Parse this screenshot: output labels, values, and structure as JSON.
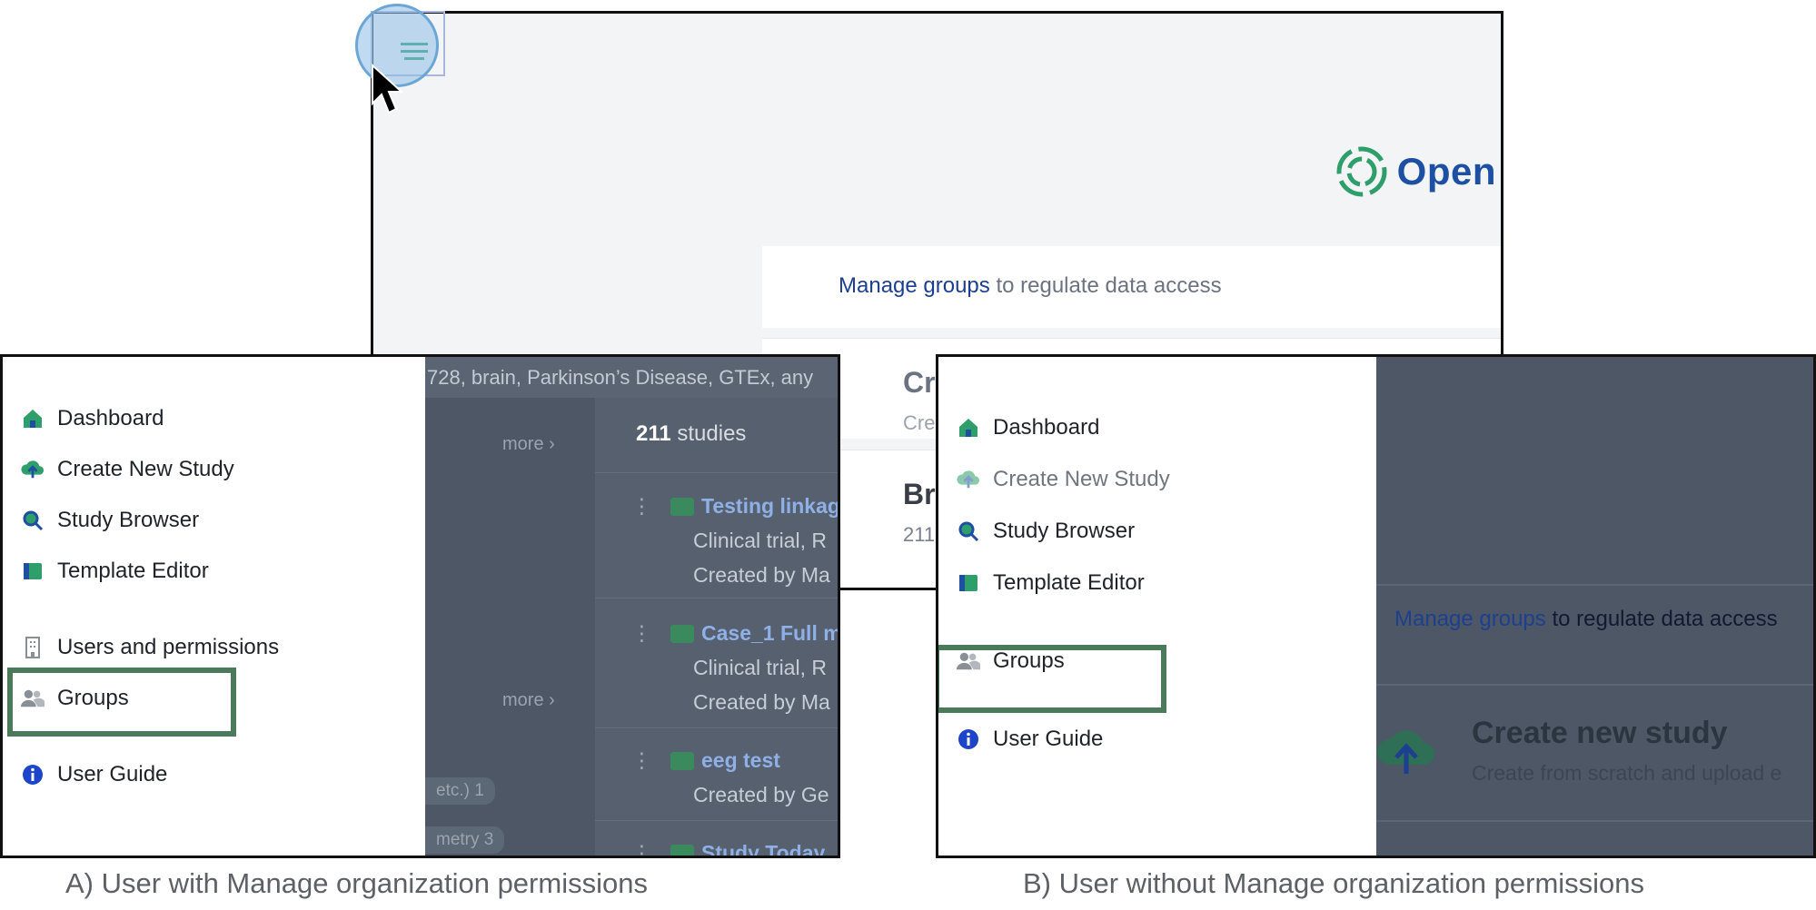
{
  "background_app": {
    "logo_text": "Open",
    "banner_link": "Manage groups",
    "banner_rest": " to regulate data access",
    "create_card_title": "Cr",
    "create_card_sub": "Cre",
    "browse_card_title": "Br",
    "browse_card_sub": "211"
  },
  "panel_a": {
    "menu": {
      "dashboard": "Dashboard",
      "create_new_study": "Create New Study",
      "study_browser": "Study Browser",
      "template_editor": "Template Editor",
      "users_permissions": "Users and permissions",
      "groups": "Groups",
      "user_guide": "User Guide"
    },
    "search_text": "728, brain, Parkinson’s Disease, GTEx, any",
    "more_label": "more",
    "chips": [
      "etc.) 1",
      "metry 3"
    ],
    "study_count": "211",
    "study_count_label": " studies",
    "studies": [
      {
        "title": "Testing linkag",
        "line2": "Clinical trial, R",
        "line3": "Created by Ma"
      },
      {
        "title": "Case_1 Full m",
        "line2": "Clinical trial, R",
        "line3": "Created by Ma"
      },
      {
        "title": "eeg test",
        "line2": "Created by Ge",
        "line3": ""
      },
      {
        "title": "Study Today",
        "line2": "",
        "line3": ""
      }
    ],
    "caption": "A) User with Manage organization permissions"
  },
  "panel_b": {
    "menu": {
      "dashboard": "Dashboard",
      "create_new_study": "Create New Study",
      "study_browser": "Study Browser",
      "template_editor": "Template Editor",
      "groups": "Groups",
      "user_guide": "User Guide"
    },
    "banner_link": "Manage groups",
    "banner_rest": " to regulate data access",
    "create_title": "Create new study",
    "create_sub": "Create from scratch and upload e",
    "caption": "B) User without Manage organization permissions"
  },
  "colors": {
    "highlight_box": "#4a7a5a",
    "brand_green": "#2e9e6a",
    "brand_blue": "#1d4fa3",
    "overlay": "#4d5766"
  }
}
